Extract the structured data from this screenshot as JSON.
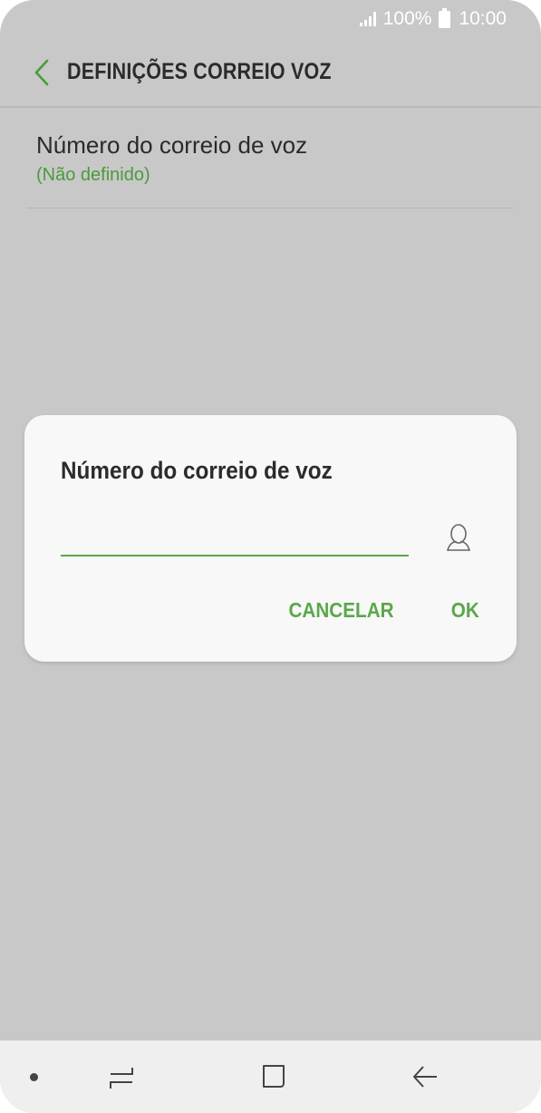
{
  "status_bar": {
    "battery": "100%",
    "time": "10:00",
    "signal_icon": "signal-icon",
    "battery_icon": "battery-icon"
  },
  "header": {
    "title": "DEFINIÇÕES CORREIO VOZ",
    "back_icon": "chevron-left-icon"
  },
  "settings": {
    "items": [
      {
        "title": "Número do correio de voz",
        "subtitle": "(Não definido)"
      }
    ]
  },
  "dialog": {
    "title": "Número do correio de voz",
    "input_value": "",
    "contact_icon": "contact-icon",
    "cancel_label": "CANCELAR",
    "ok_label": "OK"
  },
  "nav_bar": {
    "recents_icon": "recents-icon",
    "home_icon": "home-icon",
    "back_icon": "back-arrow-icon"
  },
  "colors": {
    "accent": "#5aa84a",
    "background_dim": "#c8c8c8",
    "dialog_bg": "#f8f8f8"
  }
}
